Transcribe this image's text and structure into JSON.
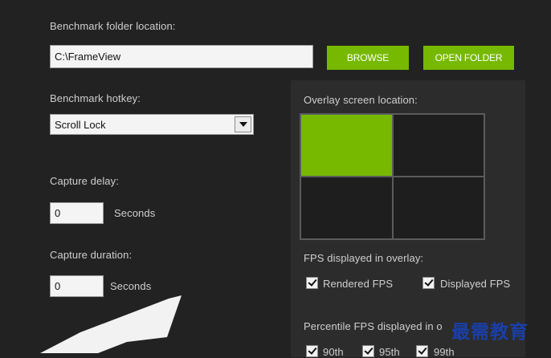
{
  "folder": {
    "label": "Benchmark folder location:",
    "value": "C:\\FrameView",
    "browse_label": "BROWSE",
    "open_label": "OPEN FOLDER"
  },
  "hotkey": {
    "label": "Benchmark hotkey:",
    "selected": "Scroll Lock"
  },
  "delay": {
    "label": "Capture delay:",
    "value": "0",
    "unit": "Seconds"
  },
  "duration": {
    "label": "Capture duration:",
    "value": "0",
    "unit": "Seconds"
  },
  "overlay": {
    "label": "Overlay screen location:",
    "selected_cell": "top-left"
  },
  "fps": {
    "label": "FPS displayed in overlay:",
    "rendered": {
      "label": "Rendered FPS",
      "checked": true
    },
    "displayed": {
      "label": "Displayed FPS",
      "checked": true
    }
  },
  "percentile": {
    "label": "Percentile FPS displayed in o",
    "items": [
      {
        "label": "90th",
        "checked": true
      },
      {
        "label": "95th",
        "checked": true
      },
      {
        "label": "99th",
        "checked": true
      }
    ]
  },
  "watermark": "最需教育",
  "colors": {
    "accent": "#76b900",
    "background": "#222222",
    "panel": "#2c2c2c"
  }
}
